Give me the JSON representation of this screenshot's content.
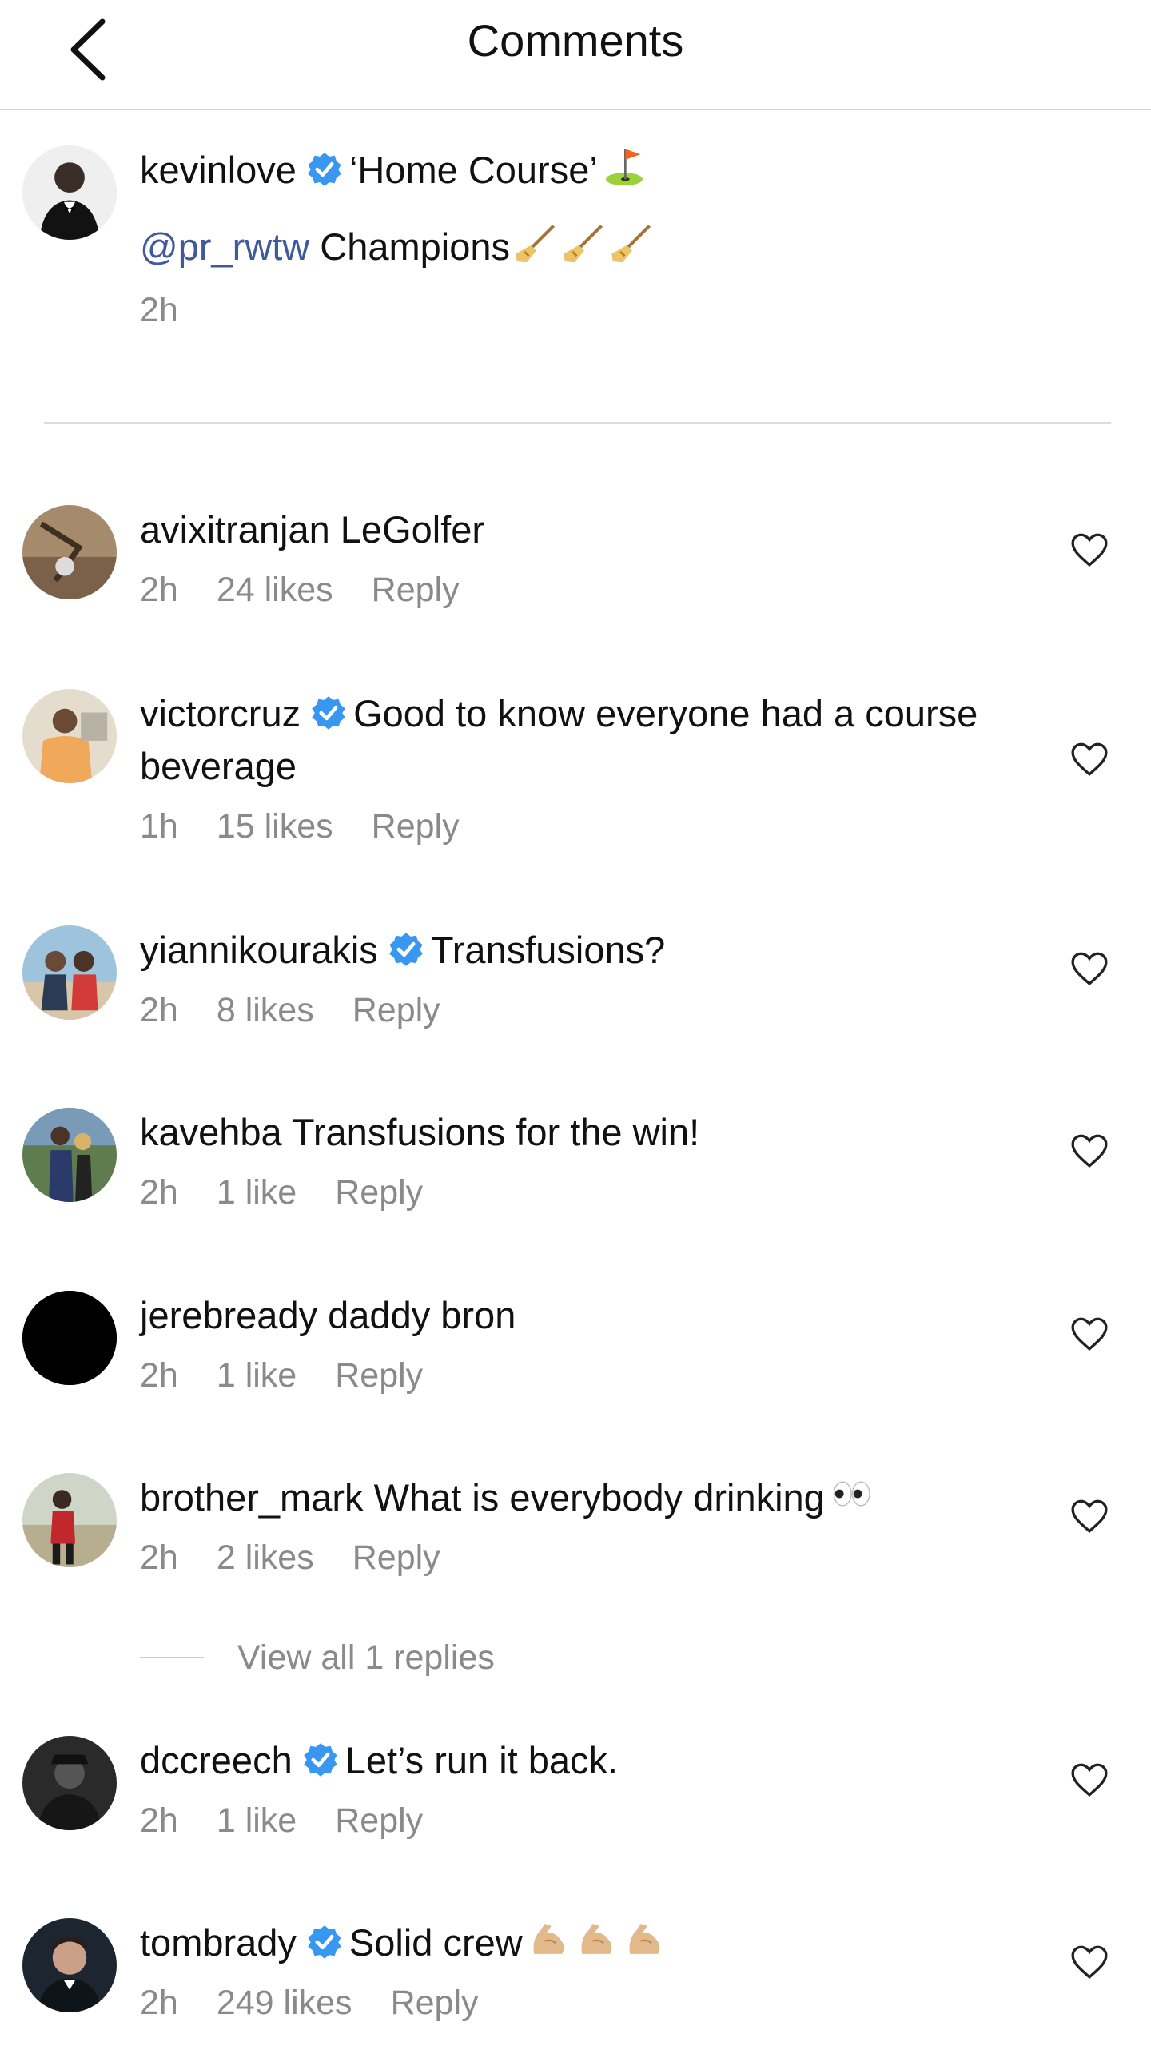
{
  "header": {
    "title": "Comments",
    "back_icon": "chevron-left-icon"
  },
  "caption": {
    "username": "kevinlove",
    "verified": true,
    "text": "‘Home Course’",
    "flag_emoji": "golf-flag-emoji",
    "mention": "@pr_rwtw",
    "text2": "Champions",
    "broom_emoji": "broom-emoji",
    "time": "2h"
  },
  "comments": [
    {
      "username": "avixitranjan",
      "verified": false,
      "text": "LeGolfer",
      "time": "2h",
      "likes": "24 likes",
      "reply": "Reply"
    },
    {
      "username": "victorcruz",
      "verified": true,
      "text": "Good to know everyone had a course beverage",
      "time": "1h",
      "likes": "15 likes",
      "reply": "Reply"
    },
    {
      "username": "yiannikourakis",
      "verified": true,
      "text": "Transfusions?",
      "time": "2h",
      "likes": "8 likes",
      "reply": "Reply"
    },
    {
      "username": "kavehba",
      "verified": false,
      "text": "Transfusions for the win!",
      "time": "2h",
      "likes": "1 like",
      "reply": "Reply"
    },
    {
      "username": "jerebready",
      "verified": false,
      "text": "daddy bron",
      "time": "2h",
      "likes": "1 like",
      "reply": "Reply"
    },
    {
      "username": "brother_mark",
      "verified": false,
      "text": "What is everybody drinking",
      "emoji": "eyes-emoji",
      "time": "2h",
      "likes": "2 likes",
      "reply": "Reply"
    },
    {
      "username": "dccreech",
      "verified": true,
      "text": "Let’s run it back.",
      "time": "2h",
      "likes": "1 like",
      "reply": "Reply"
    },
    {
      "username": "tombrady",
      "verified": true,
      "text": "Solid crew",
      "emoji": "flexed-biceps-emoji",
      "time": "2h",
      "likes": "249 likes",
      "reply": "Reply"
    }
  ],
  "view_replies": "View all 1 replies",
  "colors": {
    "mention": "#40589c",
    "verified": "#3897f0",
    "meta": "#8a8a8a",
    "divider": "#dcdcdc"
  }
}
